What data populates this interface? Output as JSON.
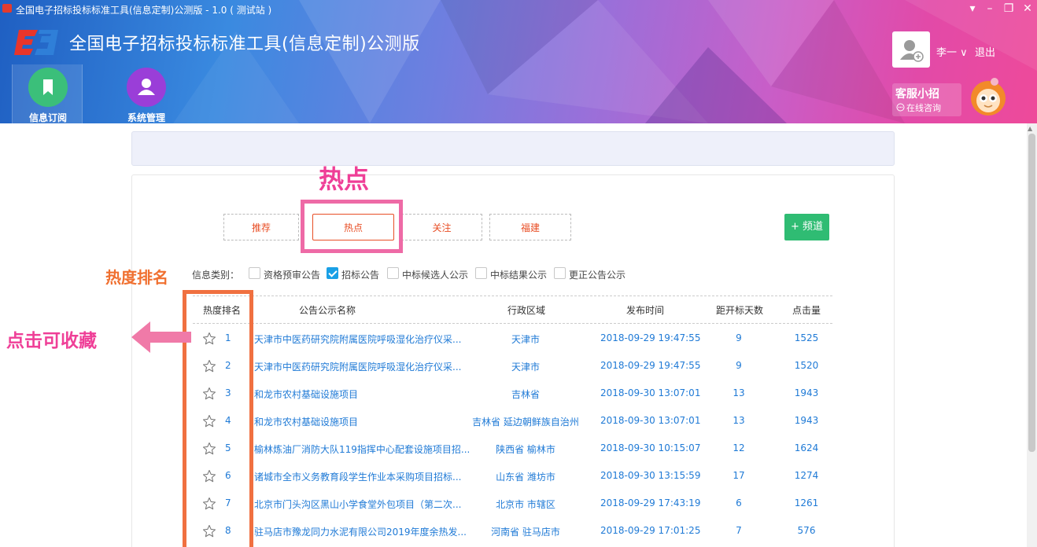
{
  "window": {
    "title": "全国电子招标投标标准工具(信息定制)公测版 - 1.0 ( 测试站 )",
    "controls": [
      "▾",
      "–",
      "❐",
      "✕"
    ]
  },
  "header": {
    "app_title": "全国电子招标投标标准工具(信息定制)公测版",
    "nav": [
      {
        "label": "信息订阅",
        "icon": "bookmark-icon",
        "color": "#3bbf7a"
      },
      {
        "label": "系统管理",
        "icon": "user-icon",
        "color": "#9a3ed8"
      }
    ],
    "user": {
      "name": "李一 ∨",
      "logout": "退出"
    },
    "customer_service": {
      "title": "客服小招",
      "subtitle": "在线咨询"
    }
  },
  "tabs": [
    {
      "label": "推荐",
      "active": false
    },
    {
      "label": "热点",
      "active": true
    },
    {
      "label": "关注",
      "active": false
    },
    {
      "label": "福建",
      "active": false
    }
  ],
  "channel_button": "+ 频道",
  "filter": {
    "label": "信息类别：",
    "options": [
      {
        "label": "资格预审公告",
        "checked": false
      },
      {
        "label": "招标公告",
        "checked": true
      },
      {
        "label": "中标候选人公示",
        "checked": false
      },
      {
        "label": "中标结果公示",
        "checked": false
      },
      {
        "label": "更正公告公示",
        "checked": false
      }
    ]
  },
  "table": {
    "headers": [
      "热度排名",
      "公告公示名称",
      "行政区域",
      "发布时间",
      "距开标天数",
      "点击量"
    ],
    "rows": [
      {
        "rank": "1",
        "name": "天津市中医药研究院附属医院呼吸湿化治疗仪采...",
        "region": "天津市",
        "time": "2018-09-29 19:47:55",
        "days": "9",
        "clicks": "1525"
      },
      {
        "rank": "2",
        "name": "天津市中医药研究院附属医院呼吸湿化治疗仪采...",
        "region": "天津市",
        "time": "2018-09-29 19:47:55",
        "days": "9",
        "clicks": "1520"
      },
      {
        "rank": "3",
        "name": "和龙市农村基础设施项目",
        "region": "吉林省",
        "time": "2018-09-30 13:07:01",
        "days": "13",
        "clicks": "1943"
      },
      {
        "rank": "4",
        "name": "和龙市农村基础设施项目",
        "region": "吉林省 延边朝鲜族自治州",
        "time": "2018-09-30 13:07:01",
        "days": "13",
        "clicks": "1943"
      },
      {
        "rank": "5",
        "name": "榆林炼油厂消防大队119指挥中心配套设施项目招...",
        "region": "陕西省 榆林市",
        "time": "2018-09-30 10:15:07",
        "days": "12",
        "clicks": "1624"
      },
      {
        "rank": "6",
        "name": "诸城市全市义务教育段学生作业本采购项目招标...",
        "region": "山东省 潍坊市",
        "time": "2018-09-30 13:15:59",
        "days": "17",
        "clicks": "1274"
      },
      {
        "rank": "7",
        "name": "北京市门头沟区黑山小学食堂外包项目（第二次...",
        "region": "北京市 市辖区",
        "time": "2018-09-29 17:43:19",
        "days": "6",
        "clicks": "1261"
      },
      {
        "rank": "8",
        "name": "驻马店市豫龙同力水泥有限公司2019年度余热发...",
        "region": "河南省 驻马店市",
        "time": "2018-09-29 17:01:25",
        "days": "7",
        "clicks": "576"
      }
    ]
  },
  "annotations": {
    "hot": "热点",
    "rank": "热度排名",
    "favorite": "点击可收藏"
  },
  "colors": {
    "accent_orange": "#e84e25",
    "link_blue": "#1f7ad6",
    "green": "#2fbc73",
    "annotation_pink": "#ef3f97",
    "annotation_orange": "#f07030"
  }
}
